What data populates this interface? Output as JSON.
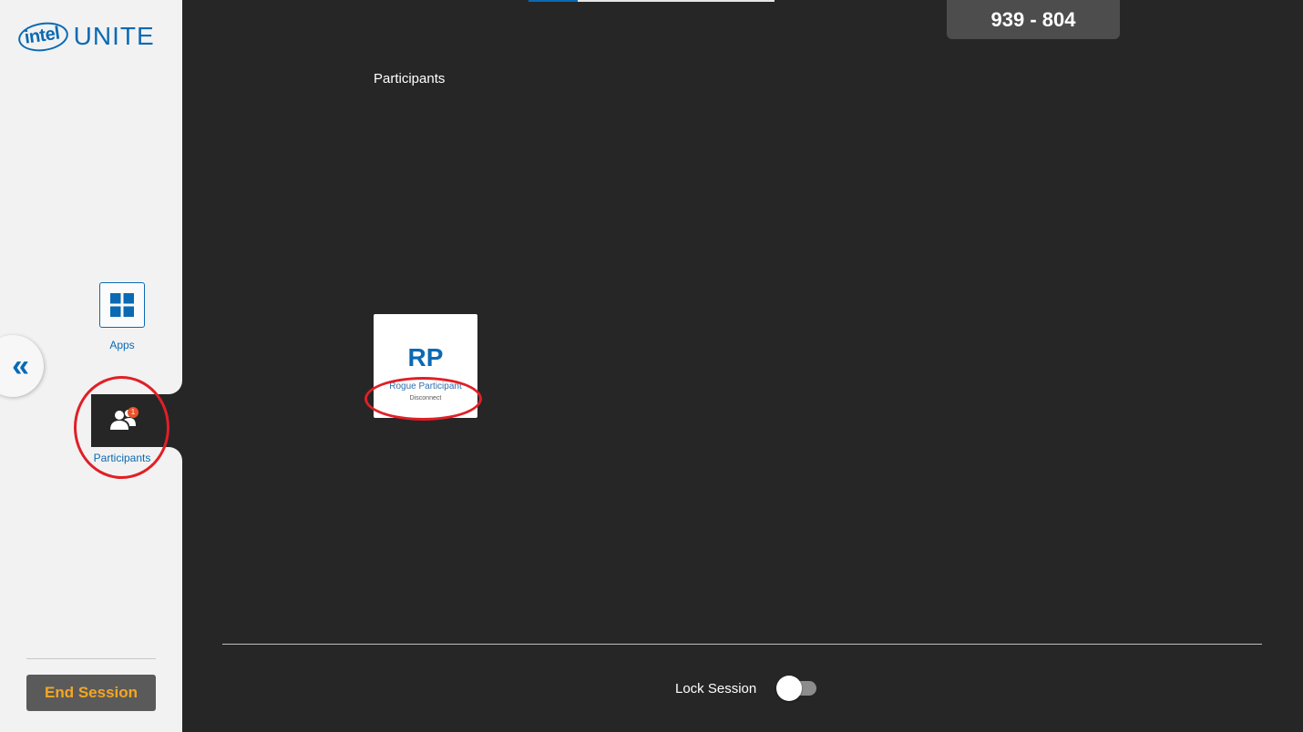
{
  "brand": {
    "logo_intel": "intel",
    "logo_product": "UNITE",
    "accent_color": "#0a6ab3"
  },
  "sidebar": {
    "collapse_icon": "double-chevron-left-icon",
    "collapse_glyph": "«",
    "items": [
      {
        "label": "Apps",
        "icon": "grid-icon",
        "active": false
      },
      {
        "label": "Participants",
        "icon": "people-icon",
        "active": true,
        "badge": "1"
      }
    ],
    "end_session_label": "End Session",
    "end_session_color": "#f5a623"
  },
  "header": {
    "pin": "939 - 804"
  },
  "main": {
    "title": "Participants",
    "participants": [
      {
        "initials": "RP",
        "name": "Rogue Participant",
        "action": "Disconnect"
      }
    ]
  },
  "footer": {
    "lock_label": "Lock Session",
    "lock_enabled": false
  },
  "annotations": {
    "highlight_color": "#e11f26"
  }
}
